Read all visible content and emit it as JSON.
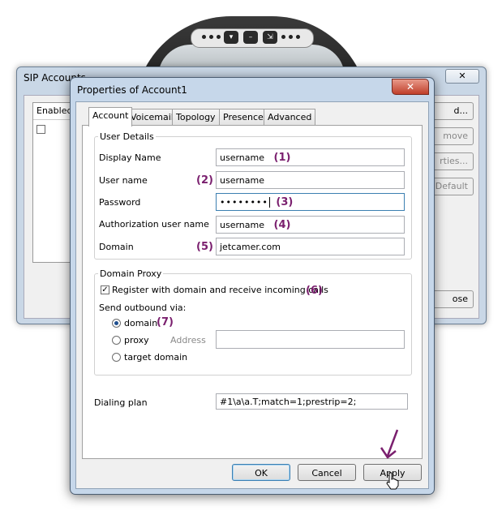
{
  "back_window": {
    "title": "SIP Accounts",
    "close_glyph": "✕",
    "list_header": "Enabled",
    "buttons": [
      "d...",
      "move",
      "rties...",
      "Default",
      "ose"
    ]
  },
  "dialog": {
    "title": "Properties of Account1",
    "close_glyph": "✕",
    "tabs": [
      "Account",
      "Voicemail",
      "Topology",
      "Presence",
      "Advanced"
    ],
    "user_details": {
      "legend": "User Details",
      "display_name_label": "Display Name",
      "display_name_value": "username",
      "user_name_label": "User name",
      "user_name_value": "username",
      "password_label": "Password",
      "password_value": "••••••••",
      "auth_user_label": "Authorization user name",
      "auth_user_value": "username",
      "domain_label": "Domain",
      "domain_value": "jetcamer.com"
    },
    "domain_proxy": {
      "legend": "Domain Proxy",
      "register_label": "Register with domain and receive incoming calls",
      "register_checked": true,
      "send_outbound_label": "Send outbound via:",
      "options": [
        "domain",
        "proxy",
        "target domain"
      ],
      "selected_option": "domain",
      "address_label": "Address",
      "address_value": ""
    },
    "dialing_plan_label": "Dialing plan",
    "dialing_plan_value": "#1\\a\\a.T;match=1;prestrip=2;",
    "buttons": {
      "ok": "OK",
      "cancel": "Cancel",
      "apply": "Apply"
    }
  },
  "annotations": [
    "(1)",
    "(2)",
    "(3)",
    "(4)",
    "(5)",
    "(6)",
    "(7)"
  ],
  "colors": {
    "annotation": "#7a1f6e",
    "dialog_frame": "#c6d7ea"
  },
  "icons": [
    "close-icon",
    "arrow-pointer-icon",
    "hand-cursor-icon"
  ]
}
